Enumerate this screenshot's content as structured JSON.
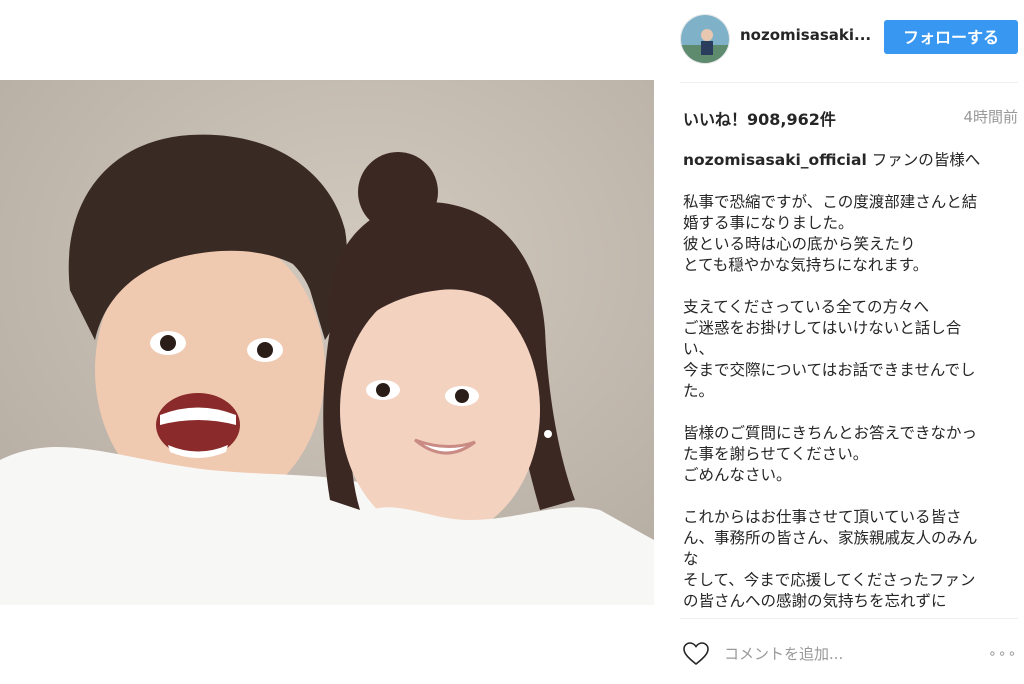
{
  "post": {
    "username": "nozomisasaki...",
    "follow_label": "フォローする",
    "likes": "いいね！908,962件",
    "time_ago": "4時間前",
    "caption_author": "nozomisasaki_official",
    "caption_first": "ファンの皆様へ",
    "caption_lines": [
      "",
      "私事で恐縮ですが、この度渡部建さんと結",
      "婚する事になりました。",
      "彼といる時は心の底から笑えたり",
      "とても穏やかな気持ちになれます。",
      "",
      "支えてくださっている全ての方々へ",
      "ご迷惑をお掛けしてはいけないと話し合",
      "い、",
      "今まで交際についてはお話できませんでし",
      "た。",
      "",
      "皆様のご質問にきちんとお答えできなかっ",
      "た事を謝らせてください。",
      "ごめんなさい。",
      "",
      "これからはお仕事させて頂いている皆さ",
      "ん、事務所の皆さん、家族親戚友人のみん",
      "な",
      "そして、今まで応援してくださったファン",
      "の皆さんへの感謝の気持ちを忘れずに"
    ],
    "comment_placeholder": "コメントを追加...",
    "more_label": "∘∘∘"
  },
  "icons": {
    "avatar": "profile-avatar",
    "heart": "heart-icon",
    "more": "more-options-icon"
  },
  "colors": {
    "accent": "#3897f0",
    "text": "#262626",
    "muted": "#999999"
  }
}
